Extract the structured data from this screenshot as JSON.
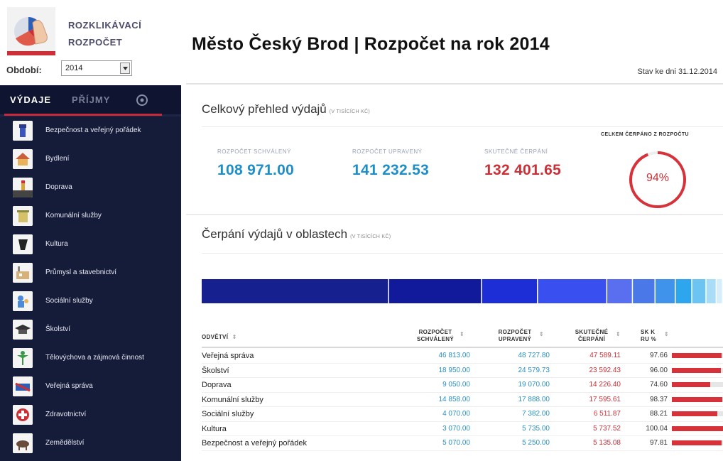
{
  "header": {
    "logo_line1": "ROZKLIKÁVACÍ",
    "logo_line2": "ROZPOČET",
    "period_label": "Období:",
    "period_value": "2014",
    "title": "Město Český Brod | Rozpočet na rok 2014",
    "as_of": "Stav ke dni 31.12.2014"
  },
  "sidebar": {
    "tabs": {
      "expenses": "VÝDAJE",
      "income": "PŘÍJMY"
    },
    "items": [
      {
        "label": "Bezpečnost a veřejný pořádek",
        "icon": "police-icon"
      },
      {
        "label": "Bydlení",
        "icon": "house-icon"
      },
      {
        "label": "Doprava",
        "icon": "traffic-light-icon"
      },
      {
        "label": "Komunální služby",
        "icon": "bin-icon"
      },
      {
        "label": "Kultura",
        "icon": "theatre-icon"
      },
      {
        "label": "Průmysl a stavebnictví",
        "icon": "factory-icon"
      },
      {
        "label": "Sociální služby",
        "icon": "care-icon"
      },
      {
        "label": "Školství",
        "icon": "school-icon"
      },
      {
        "label": "Tělovýchova a zájmová činnost",
        "icon": "sports-icon"
      },
      {
        "label": "Veřejná správa",
        "icon": "office-icon"
      },
      {
        "label": "Zdravotnictví",
        "icon": "health-icon"
      },
      {
        "label": "Zemědělství",
        "icon": "agriculture-icon"
      }
    ]
  },
  "overview": {
    "title": "Celkový přehled výdajů",
    "unit": "(V TISÍCÍCH KČ)",
    "approved_label": "ROZPOČET SCHVÁLENÝ",
    "approved_value": "108 971.00",
    "adjusted_label": "ROZPOČET UPRAVENÝ",
    "adjusted_value": "141 232.53",
    "actual_label": "SKUTEČNÉ ČERPÁNÍ",
    "actual_value": "132 401.65",
    "total_caption": "CELKEM ČERPÁNO Z ROZPOČTU",
    "total_percent": "94%",
    "total_fraction": 0.94
  },
  "areas": {
    "title": "Čerpání výdajů v oblastech",
    "unit": "(V TISÍCÍCH KČ)",
    "segments": [
      {
        "value": 47589.11,
        "color": "#16208f"
      },
      {
        "value": 23592.43,
        "color": "#101a9a"
      },
      {
        "value": 14226.4,
        "color": "#1e2ed6"
      },
      {
        "value": 17595.61,
        "color": "#3a4ff0"
      },
      {
        "value": 6511.87,
        "color": "#5a6ff0"
      },
      {
        "value": 5737.52,
        "color": "#4a78e8"
      },
      {
        "value": 5135.08,
        "color": "#3f93ea"
      },
      {
        "value": 4200.0,
        "color": "#2ea6ee"
      },
      {
        "value": 3600.0,
        "color": "#6cc4f2"
      },
      {
        "value": 2600.0,
        "color": "#a9dcf6"
      },
      {
        "value": 1600.0,
        "color": "#d5eefb"
      }
    ]
  },
  "table": {
    "headers": {
      "sector": "ODVĚTVÍ",
      "approved_1": "ROZPOČET",
      "approved_2": "SCHVÁLENÝ",
      "adjusted_1": "ROZPOČET",
      "adjusted_2": "UPRAVENÝ",
      "actual_1": "SKUTEČNÉ",
      "actual_2": "ČERPÁNÍ",
      "pct_1": "SK K",
      "pct_2": "RU %"
    },
    "rows": [
      {
        "name": "Veřejná správa",
        "approved": "46 813.00",
        "adjusted": "48 727.80",
        "actual": "47 589.11",
        "pct": "97.66",
        "fraction": 0.9766
      },
      {
        "name": "Školství",
        "approved": "18 950.00",
        "adjusted": "24 579.73",
        "actual": "23 592.43",
        "pct": "96.00",
        "fraction": 0.96
      },
      {
        "name": "Doprava",
        "approved": "9 050.00",
        "adjusted": "19 070.00",
        "actual": "14 226.40",
        "pct": "74.60",
        "fraction": 0.746
      },
      {
        "name": "Komunální služby",
        "approved": "14 858.00",
        "adjusted": "17 888.00",
        "actual": "17 595.61",
        "pct": "98.37",
        "fraction": 0.9837
      },
      {
        "name": "Sociální služby",
        "approved": "4 070.00",
        "adjusted": "7 382.00",
        "actual": "6 511.87",
        "pct": "88.21",
        "fraction": 0.8821
      },
      {
        "name": "Kultura",
        "approved": "3 070.00",
        "adjusted": "5 735.00",
        "actual": "5 737.52",
        "pct": "100.04",
        "fraction": 1.0
      },
      {
        "name": "Bezpečnost a veřejný pořádek",
        "approved": "5 070.00",
        "adjusted": "5 250.00",
        "actual": "5 135.08",
        "pct": "97.81",
        "fraction": 0.9781
      }
    ]
  }
}
